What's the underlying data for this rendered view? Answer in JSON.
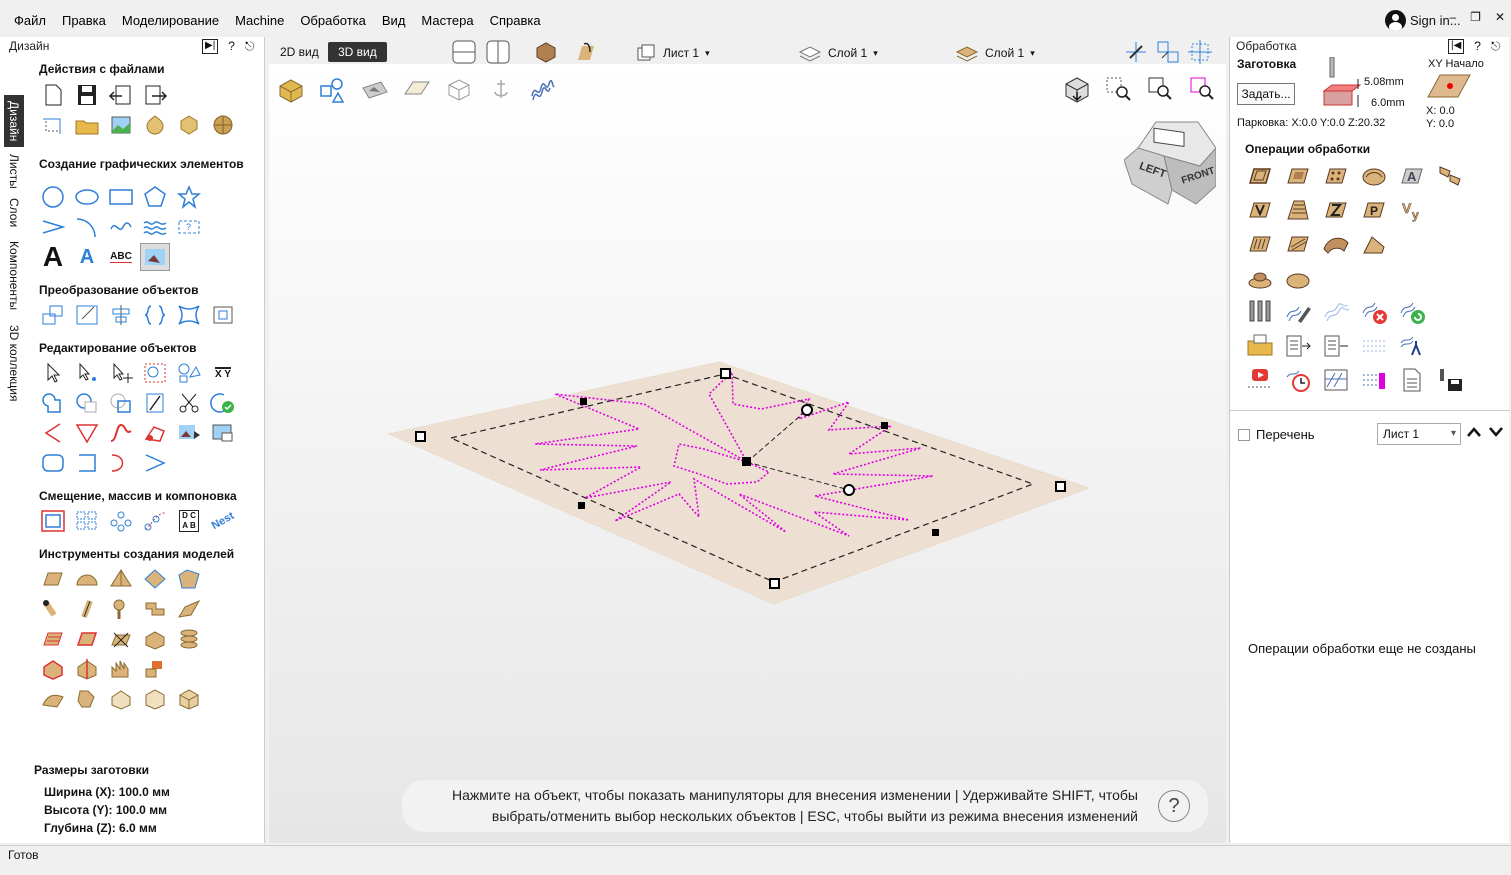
{
  "menu": [
    "Файл",
    "Правка",
    "Моделирование",
    "Machine",
    "Обработка",
    "Вид",
    "Мастера",
    "Справка"
  ],
  "signin": "Sign in...",
  "left": {
    "title": "Дизайн",
    "tabs": [
      "Дизайн",
      "Листы",
      "Слои",
      "Компоненты",
      "3D коллекция"
    ],
    "sections": [
      "Действия с файлами",
      "Создание графических элементов",
      "Преобразование объектов",
      "Редактирование объектов",
      "Смещение, массив и компоновка",
      "Инструменты создания моделей"
    ],
    "text_icons": {
      "big_a": "A",
      "abc": "ABC",
      "xy": "X Y",
      "dcab": "D C A B",
      "nest": "Nest"
    },
    "dims": {
      "title": "Размеры заготовки",
      "width": "Ширина  (X): 100.0 мм",
      "height": "Высота  (Y): 100.0 мм",
      "depth": "Глубина (Z): 6.0 мм"
    }
  },
  "toolbar": {
    "view2d": "2D вид",
    "view3d": "3D вид",
    "sheet": "Лист 1",
    "layer1": "Слой 1",
    "layer2": "Слой 1"
  },
  "cube": {
    "left": "LEFT",
    "front": "FRONT"
  },
  "hint": {
    "line1": "Нажмите на объект, чтобы показать манипуляторы для внесения изменении | Удерживайте SHIFT, чтобы",
    "line2": "выбрать/отменить выбор нескольких объектов | ESC, чтобы выйти из режима внесения изменений",
    "help": "?"
  },
  "right": {
    "title": "Обработка",
    "stock": "Заготовка",
    "set": "Задать...",
    "thickness1": "5.08mm",
    "thickness2": "6.0mm",
    "xyorigin": "XY Начало",
    "x": "X: 0.0",
    "y": "Y: 0.0",
    "park": "Парковка:  X:0.0 Y:0.0 Z:20.32",
    "ops_title": "Операции обработки",
    "list": "Перечень",
    "list_sheet": "Лист 1",
    "empty": "Операции обработки еще не созданы"
  },
  "status": "Готов",
  "colors": {
    "accent": "#2f7fd8",
    "path": "#e000e0",
    "wood": "#d9b37a",
    "dark": "#333333"
  }
}
